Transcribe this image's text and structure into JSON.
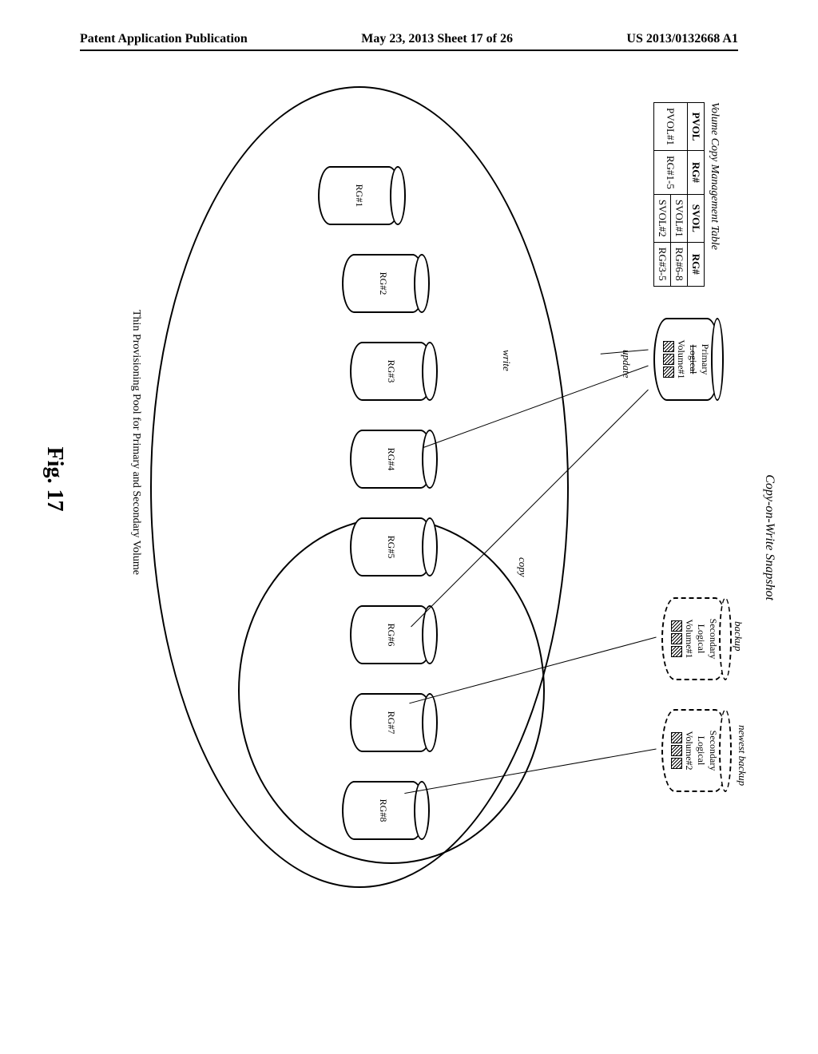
{
  "header": {
    "left": "Patent Application Publication",
    "center": "May 23, 2013  Sheet 17 of 26",
    "right": "US 2013/0132668 A1"
  },
  "figure_label": "Fig. 17",
  "snapshot_title": "Copy-on-Write Snapshot",
  "vc_table": {
    "title": "Volume Copy Management Table",
    "headers": [
      "PVOL",
      "RG#",
      "SVOL",
      "RG#"
    ],
    "rows": [
      [
        "PVOL#1",
        "RG#1-5",
        "SVOL#1",
        "RG#6-8"
      ],
      [
        "",
        "",
        "SVOL#2",
        "RG#3-5"
      ]
    ]
  },
  "primary_vol": {
    "line1": "Primary",
    "line2": "Logical",
    "line3": "Volume#1"
  },
  "secondary_vols": [
    {
      "line1": "Secondary",
      "line2": "Logical",
      "line3": "Volume#1"
    },
    {
      "line1": "Secondary",
      "line2": "Logical",
      "line3": "Volume#2"
    }
  ],
  "labels": {
    "update": "update",
    "write": "write",
    "copy": "copy",
    "backup": "backup",
    "newest_backup": "newest backup"
  },
  "raid_groups": [
    "RG#1",
    "RG#2",
    "RG#3",
    "RG#4",
    "RG#5",
    "RG#6",
    "RG#7",
    "RG#8"
  ],
  "pool_label": "Thin Provisioning Pool for Primary and Secondary Volume",
  "chart_data": {
    "type": "diagram",
    "title": "Copy-on-Write Snapshot architecture",
    "components": {
      "primary_volume": "Primary Logical Volume#1",
      "secondary_volumes": [
        "Secondary Logical Volume#1 (backup)",
        "Secondary Logical Volume#2 (newest backup)"
      ],
      "raid_groups": [
        "RG#1",
        "RG#2",
        "RG#3",
        "RG#4",
        "RG#5",
        "RG#6",
        "RG#7",
        "RG#8"
      ],
      "pool": "Thin Provisioning Pool for Primary and Secondary Volume"
    },
    "relationships": [
      {
        "from": "Primary Logical Volume#1",
        "op": "write",
        "to": [
          "RG#1",
          "RG#2",
          "RG#3"
        ]
      },
      {
        "from": "Primary Logical Volume#1",
        "op": "copy",
        "to": [
          "RG#6",
          "RG#7",
          "RG#8"
        ]
      },
      {
        "from": "Secondary Logical Volume#1",
        "maps_to": [
          "RG#6",
          "RG#7",
          "RG#8"
        ]
      },
      {
        "from": "Secondary Logical Volume#2",
        "maps_to": [
          "RG#6",
          "RG#7",
          "RG#8"
        ]
      }
    ],
    "management_table": {
      "PVOL#1": {
        "PVOL_RG": "RG#1-5",
        "SVOLs": [
          {
            "id": "SVOL#1",
            "RG": "RG#6-8"
          },
          {
            "id": "SVOL#2",
            "RG": "RG#3-5"
          }
        ]
      }
    }
  }
}
